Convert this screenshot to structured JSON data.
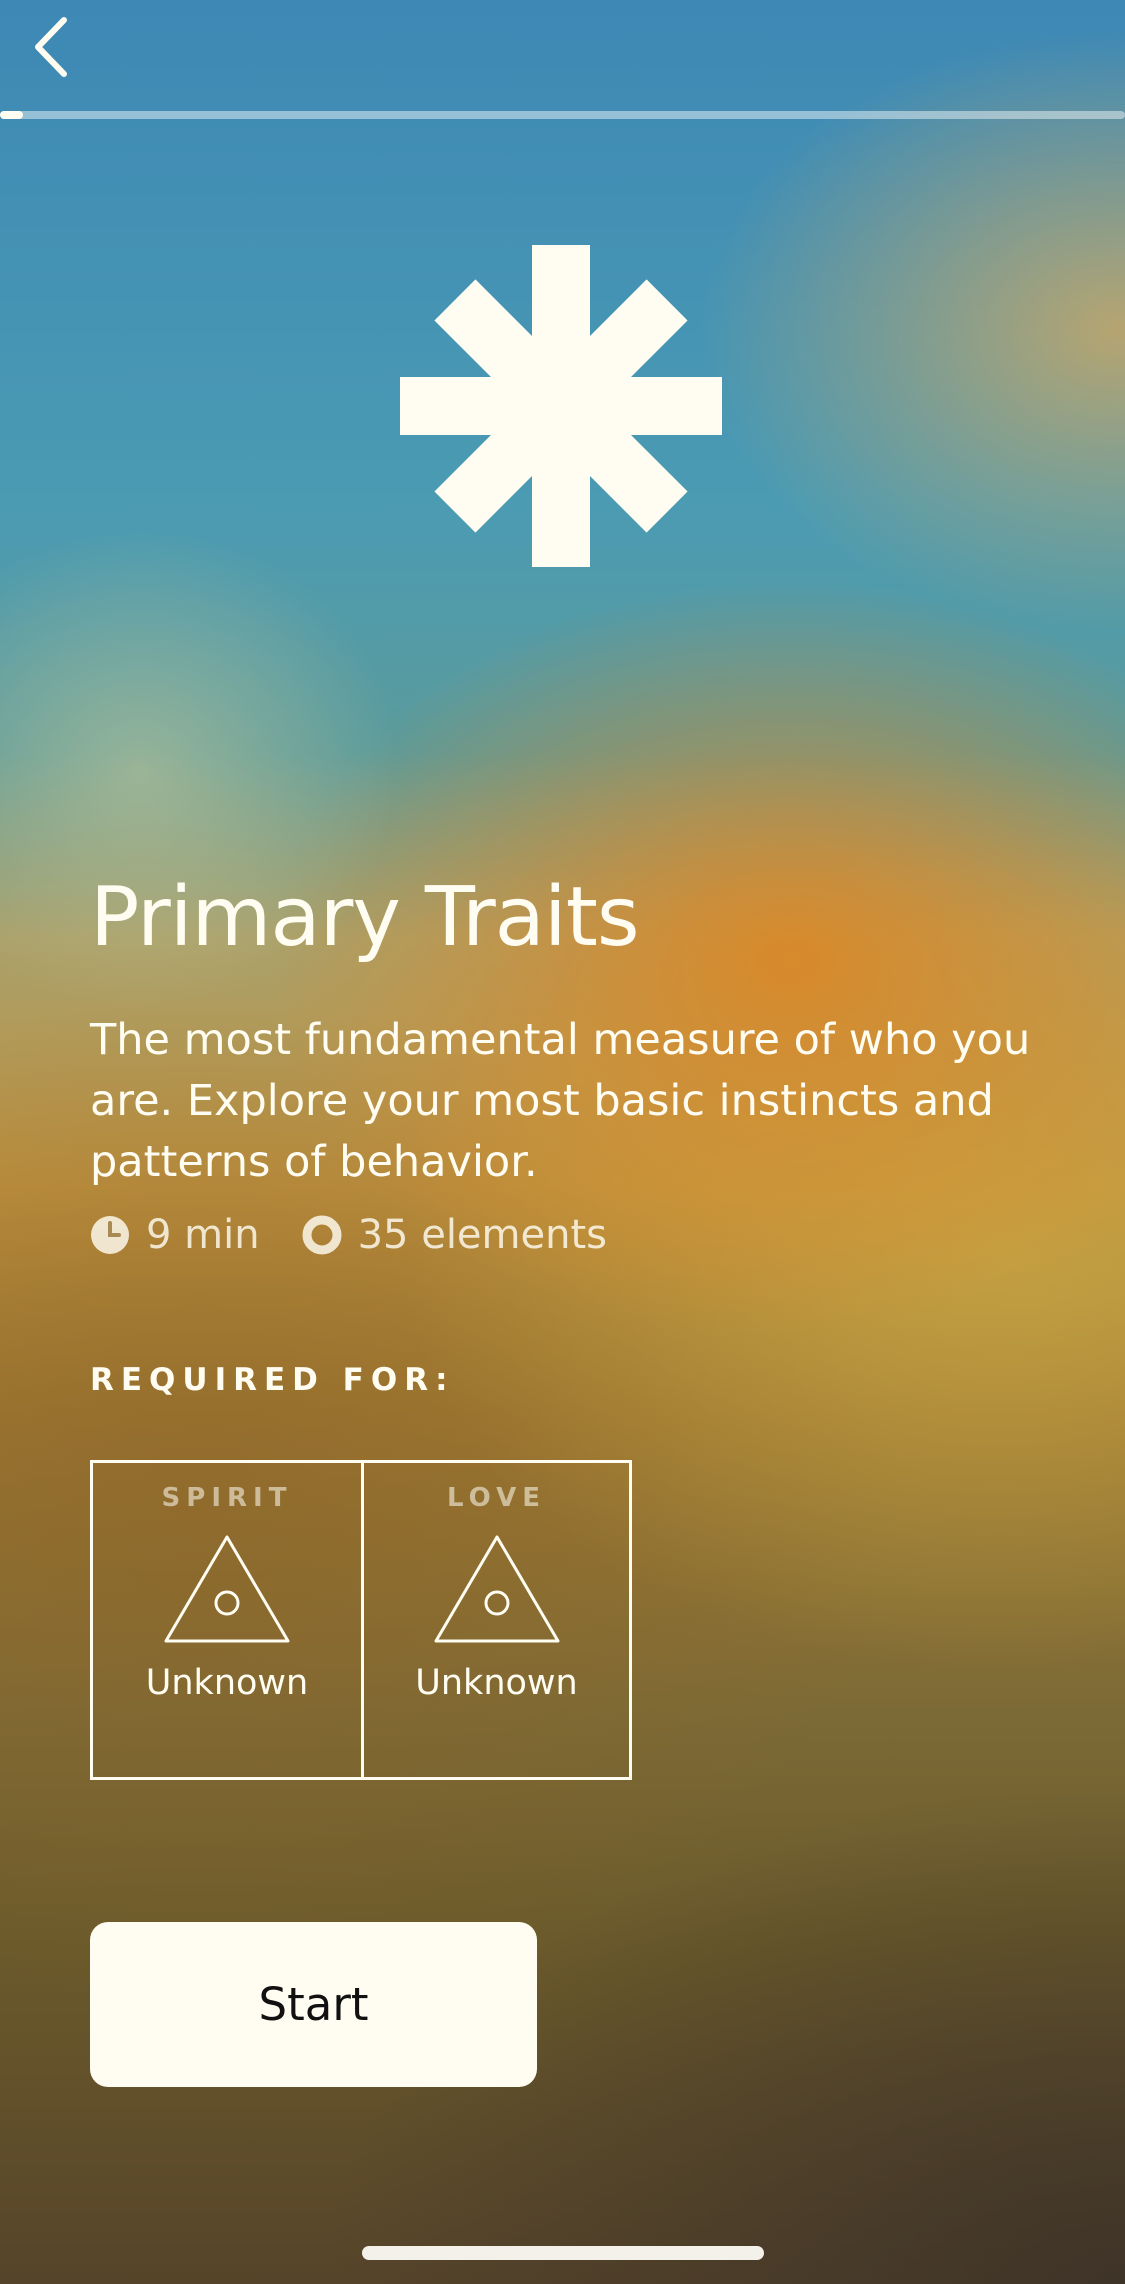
{
  "navigation": {
    "back_icon": "chevron-left-icon"
  },
  "progress": {
    "value": 0.02
  },
  "hero": {
    "icon": "asterisk-icon"
  },
  "title": "Primary Traits",
  "description": "The most fundamental measure of who you are. Explore your most basic instincts and patterns of behavior.",
  "meta": {
    "duration": "9 min",
    "duration_icon": "clock-icon",
    "elements": "35 elements",
    "elements_icon": "ring-icon"
  },
  "required_for": {
    "heading": "REQUIRED FOR:",
    "items": [
      {
        "label": "SPIRIT",
        "icon": "triangle-circle-icon",
        "value": "Unknown"
      },
      {
        "label": "LOVE",
        "icon": "triangle-circle-icon",
        "value": "Unknown"
      }
    ]
  },
  "actions": {
    "start_label": "Start"
  },
  "colors": {
    "foreground": "#fffdf2",
    "button_background": "#fffdf2",
    "button_text": "#111111"
  }
}
